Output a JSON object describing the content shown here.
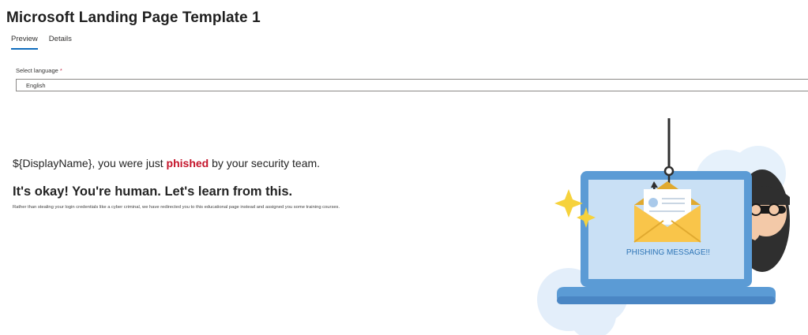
{
  "page": {
    "title": "Microsoft Landing Page Template 1"
  },
  "tabs": [
    {
      "label": "Preview",
      "active": true
    },
    {
      "label": "Details",
      "active": false
    }
  ],
  "language": {
    "label": "Select language",
    "required_mark": "*",
    "value": "English"
  },
  "content": {
    "line_prefix": "${DisplayName}, you were just ",
    "line_highlight": "phished",
    "line_suffix": " by your security team.",
    "headline": "It's okay! You're human. Let's learn from this.",
    "body": "Rather than stealing your login credentials like a cyber criminal, we have redirected you to this educational page instead and assigned you some training courses."
  },
  "illustration": {
    "caption": "PHISHING MESSAGE!!"
  },
  "colors": {
    "accent": "#0f6cbd",
    "highlight": "#c4142b",
    "laptop": "#5b9bd5",
    "screen": "#c9e0f5",
    "envelope": "#f9c54a"
  }
}
